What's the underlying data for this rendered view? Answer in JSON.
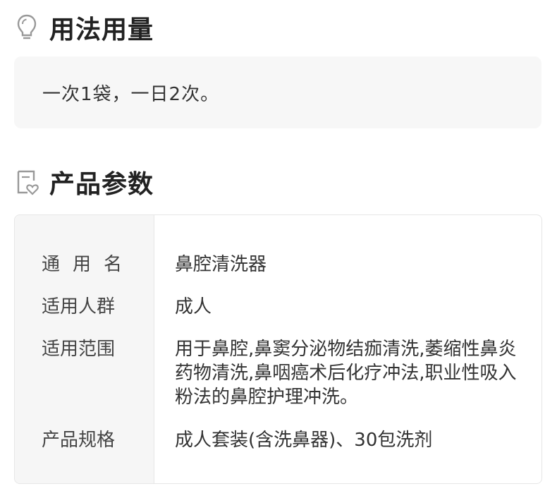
{
  "usage": {
    "title": "用法用量",
    "icon": "lightbulb-icon",
    "text": "一次1袋，一日2次。"
  },
  "params": {
    "title": "产品参数",
    "icon": "document-heart-icon",
    "rows": [
      {
        "label": "通用名",
        "value": "鼻腔清洗器"
      },
      {
        "label": "适用人群",
        "value": "成人"
      },
      {
        "label": "适用范围",
        "value": "用于鼻腔,鼻窦分泌物结痂清洗,萎缩性鼻炎药物清洗,鼻咽癌术后化疗冲法,职业性吸入粉法的鼻腔护理冲洗。"
      },
      {
        "label": "产品规格",
        "value": "成人套装(含洗鼻器)、30包洗剂"
      }
    ]
  },
  "colors": {
    "title": "#222222",
    "text": "#333333",
    "label_bg": "#f6f6f6",
    "box_bg": "#f7f7f7",
    "border": "#e6e6e6",
    "icon": "#999999"
  }
}
